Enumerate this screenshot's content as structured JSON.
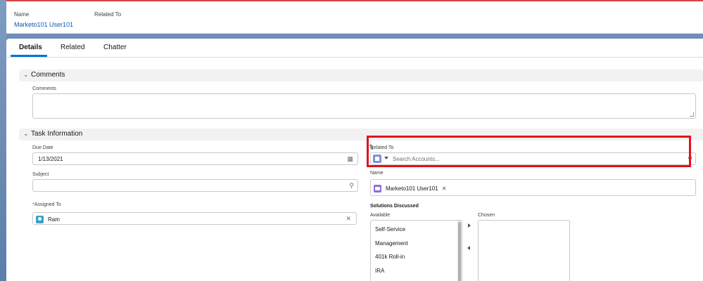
{
  "header": {
    "name_label": "Name",
    "name_value": "Marketo101 User101",
    "related_label": "Related To"
  },
  "tabs": [
    {
      "label": "Details",
      "active": true
    },
    {
      "label": "Related",
      "active": false
    },
    {
      "label": "Chatter",
      "active": false
    }
  ],
  "comments_section": {
    "title": "Comments",
    "field_label": "Comments",
    "value": ""
  },
  "task_section": {
    "title": "Task Information",
    "due_date_label": "Due Date",
    "due_date_value": "1/13/2021",
    "subject_label": "Subject",
    "subject_value": "",
    "assigned_required_mark": "*",
    "assigned_label": "Assigned To",
    "assigned_value": "Ram",
    "related_label": "Related To",
    "related_placeholder": "Search Accounts...",
    "name_label": "Name",
    "name_value": "Marketo101 User101",
    "solutions_label": "Solutions Discussed",
    "available_label": "Available",
    "chosen_label": "Chosen",
    "available_options": [
      "Self-Service",
      "Management",
      "401k Roll-in",
      "IRA"
    ]
  },
  "icons": {
    "calendar": "calendar-icon",
    "search": "search-icon",
    "clear": "close-icon",
    "chevron": "chevron-down-icon"
  },
  "colors": {
    "accent": "#0176d3",
    "highlight_box": "#e0121c",
    "link": "#0b5cab"
  }
}
